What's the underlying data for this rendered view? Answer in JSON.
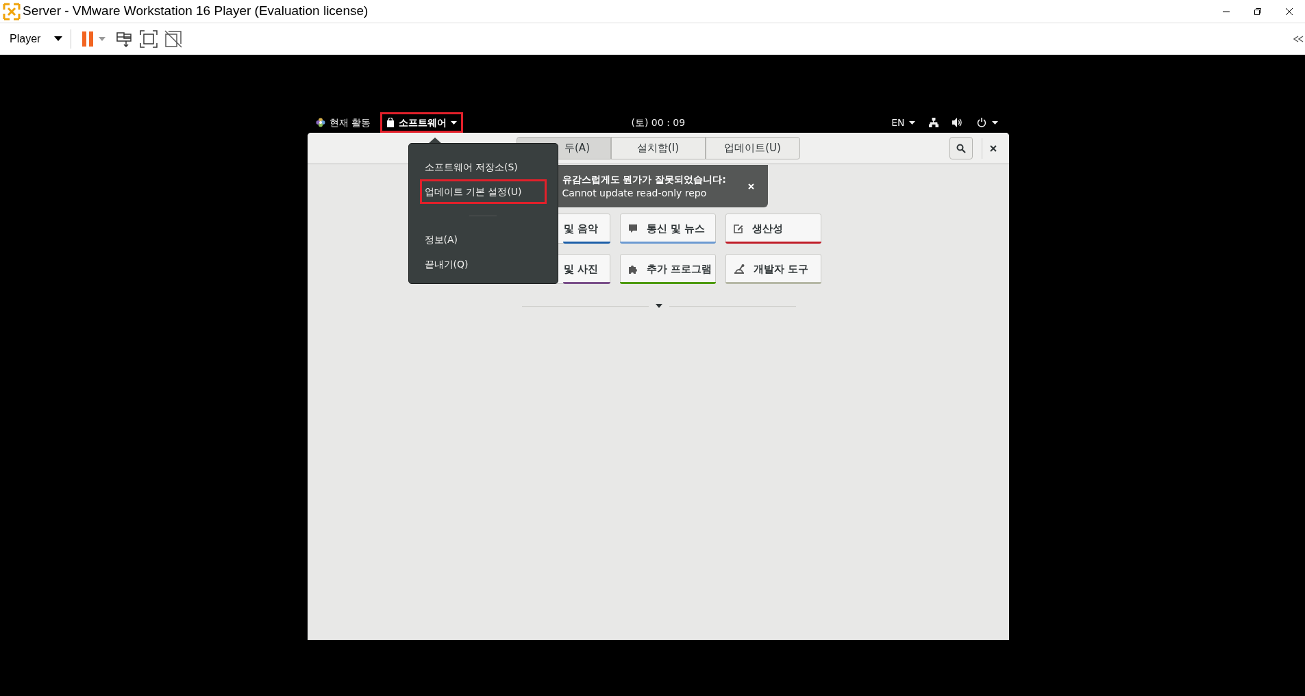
{
  "window": {
    "title": "Server - VMware Workstation 16 Player (Evaluation license)"
  },
  "toolbar": {
    "player_menu": "Player"
  },
  "guest": {
    "top_bar": {
      "activities": "현재 활동",
      "app_menu": {
        "label": "소프트웨어",
        "highlighted": true
      },
      "clock": "(토) 00 : 09",
      "input_source": "EN"
    },
    "tabs": [
      {
        "label": "두(A)",
        "selected": true
      },
      {
        "label": "설치함(I)",
        "selected": false
      },
      {
        "label": "업데이트(U)",
        "selected": false
      }
    ],
    "app_menu_popup": [
      {
        "kind": "item",
        "label": "소프트웨어 저장소(S)",
        "highlighted": false
      },
      {
        "kind": "item",
        "label": "업데이트 기본 설정(U)",
        "highlighted": true
      },
      {
        "kind": "separator"
      },
      {
        "kind": "item",
        "label": "정보(A)",
        "highlighted": false
      },
      {
        "kind": "item",
        "label": "끝내기(Q)",
        "highlighted": false
      }
    ],
    "notification": {
      "title": "유감스럽게도 뭔가가 잘못되었습니다:",
      "message": "Cannot update read-only repo"
    },
    "categories": [
      {
        "label": "및 음악",
        "color": "#1c5fa8"
      },
      {
        "label": "통신 및 뉴스",
        "color": "#6b9ad1"
      },
      {
        "label": "생산성",
        "color": "#c01c28"
      },
      {
        "label": "및 사진",
        "color": "#7a4f8a"
      },
      {
        "label": "추가 프로그램",
        "color": "#4e9a06"
      },
      {
        "label": "개발자 도구",
        "color": "#b6b8a6"
      }
    ]
  }
}
